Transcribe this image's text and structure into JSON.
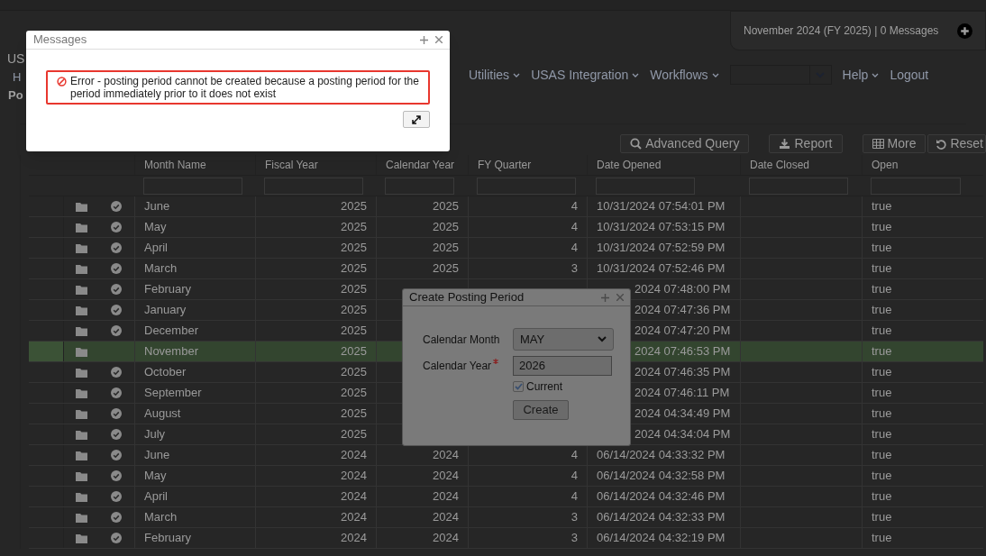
{
  "status_panel": {
    "text": "November 2024 (FY 2025) | 0 Messages"
  },
  "left_fragments": [
    "US",
    "H",
    "Po"
  ],
  "nav": [
    {
      "label": "Utilities",
      "caret": true
    },
    {
      "label": "USAS Integration",
      "caret": true
    },
    {
      "label": "Workflows",
      "caret": true
    },
    {
      "kind": "select"
    },
    {
      "label": "Help",
      "caret": true
    },
    {
      "label": "Logout",
      "caret": false
    }
  ],
  "toolbar": [
    {
      "label": "Advanced Query",
      "kind": "search"
    },
    {
      "label": "Report",
      "kind": "download"
    },
    {
      "label": "More",
      "kind": "table"
    },
    {
      "label": "Reset",
      "kind": "undo"
    }
  ],
  "table": {
    "columns": [
      "Month Name",
      "Fiscal Year",
      "Calendar Year",
      "FY Quarter",
      "Date Opened",
      "Date Closed",
      "Open"
    ],
    "rows": [
      {
        "month": "June",
        "fiscal_year": "2025",
        "calendar_year": "2025",
        "fy_quarter": "4",
        "date_opened": "10/31/2024 07:54:01 PM",
        "open": "true",
        "current": false
      },
      {
        "month": "May",
        "fiscal_year": "2025",
        "calendar_year": "2025",
        "fy_quarter": "4",
        "date_opened": "10/31/2024 07:53:15 PM",
        "open": "true",
        "current": false
      },
      {
        "month": "April",
        "fiscal_year": "2025",
        "calendar_year": "2025",
        "fy_quarter": "4",
        "date_opened": "10/31/2024 07:52:59 PM",
        "open": "true",
        "current": false
      },
      {
        "month": "March",
        "fiscal_year": "2025",
        "calendar_year": "2025",
        "fy_quarter": "3",
        "date_opened": "10/31/2024 07:52:46 PM",
        "open": "true",
        "current": false
      },
      {
        "month": "February",
        "fiscal_year": "2025",
        "date_opened": "2024 07:48:00 PM",
        "open": "true",
        "current": false
      },
      {
        "month": "January",
        "fiscal_year": "2025",
        "date_opened": "2024 07:47:36 PM",
        "open": "true",
        "current": false
      },
      {
        "month": "December",
        "fiscal_year": "2025",
        "date_opened": "2024 07:47:20 PM",
        "open": "true",
        "current": false
      },
      {
        "month": "November",
        "fiscal_year": "2025",
        "date_opened": "2024 07:46:53 PM",
        "open": "true",
        "current": true
      },
      {
        "month": "October",
        "fiscal_year": "2025",
        "date_opened": "2024 07:46:35 PM",
        "open": "true",
        "current": false
      },
      {
        "month": "September",
        "fiscal_year": "2025",
        "date_opened": "2024 07:46:11 PM",
        "open": "true",
        "current": false
      },
      {
        "month": "August",
        "fiscal_year": "2025",
        "date_opened": "2024 04:34:49 PM",
        "open": "true",
        "current": false
      },
      {
        "month": "July",
        "fiscal_year": "2025",
        "date_opened": "2024 04:34:04 PM",
        "open": "true",
        "current": false
      },
      {
        "month": "June",
        "fiscal_year": "2024",
        "calendar_year": "2024",
        "fy_quarter": "4",
        "date_opened": "06/14/2024 04:33:32 PM",
        "open": "true",
        "current": false
      },
      {
        "month": "May",
        "fiscal_year": "2024",
        "calendar_year": "2024",
        "fy_quarter": "4",
        "date_opened": "06/14/2024 04:32:58 PM",
        "open": "true",
        "current": false
      },
      {
        "month": "April",
        "fiscal_year": "2024",
        "calendar_year": "2024",
        "fy_quarter": "4",
        "date_opened": "06/14/2024 04:32:46 PM",
        "open": "true",
        "current": false
      },
      {
        "month": "March",
        "fiscal_year": "2024",
        "calendar_year": "2024",
        "fy_quarter": "3",
        "date_opened": "06/14/2024 04:32:33 PM",
        "open": "true",
        "current": false
      },
      {
        "month": "February",
        "fiscal_year": "2024",
        "calendar_year": "2024",
        "fy_quarter": "3",
        "date_opened": "06/14/2024 04:32:19 PM",
        "open": "true",
        "current": false
      }
    ]
  },
  "create_dialog": {
    "title": "Create Posting Period",
    "month_label": "Calendar Month",
    "month_value": "MAY",
    "year_label": "Calendar Year",
    "year_required": true,
    "year_value": "2026",
    "current_label": "Current",
    "current_checked": true,
    "button": "Create"
  },
  "messages_dialog": {
    "title": "Messages",
    "error": "Error - posting period cannot be created because a posting period for the period immediately prior to it does not exist"
  }
}
